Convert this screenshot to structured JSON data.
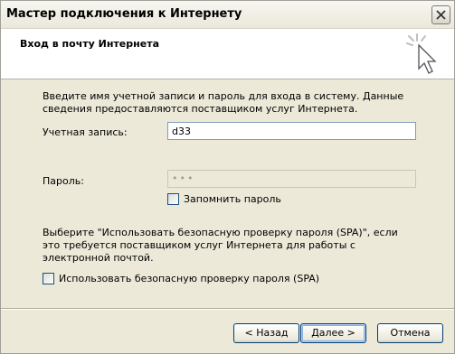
{
  "window": {
    "title": "Мастер подключения к Интернету"
  },
  "header": {
    "title": "Вход в почту Интернета"
  },
  "content": {
    "intro": "Введите имя учетной записи и пароль для входа в систему. Данные сведения предоставляются поставщиком услуг Интернета.",
    "account_label": "Учетная запись:",
    "account_value": "d33",
    "password_label": "Пароль:",
    "password_value": "•••",
    "remember_label": "Запомнить пароль",
    "spa_description": "Выберите \"Использовать безопасную проверку пароля (SPA)\", если это требуется поставщиком услуг Интернета для работы с электронной почтой.",
    "spa_label": "Использовать безопасную проверку пароля (SPA)"
  },
  "buttons": {
    "back": "< Назад",
    "next": "Далее >",
    "cancel": "Отмена"
  },
  "icons": {
    "close": "close-icon",
    "wizard": "wizard-cursor-icon"
  }
}
